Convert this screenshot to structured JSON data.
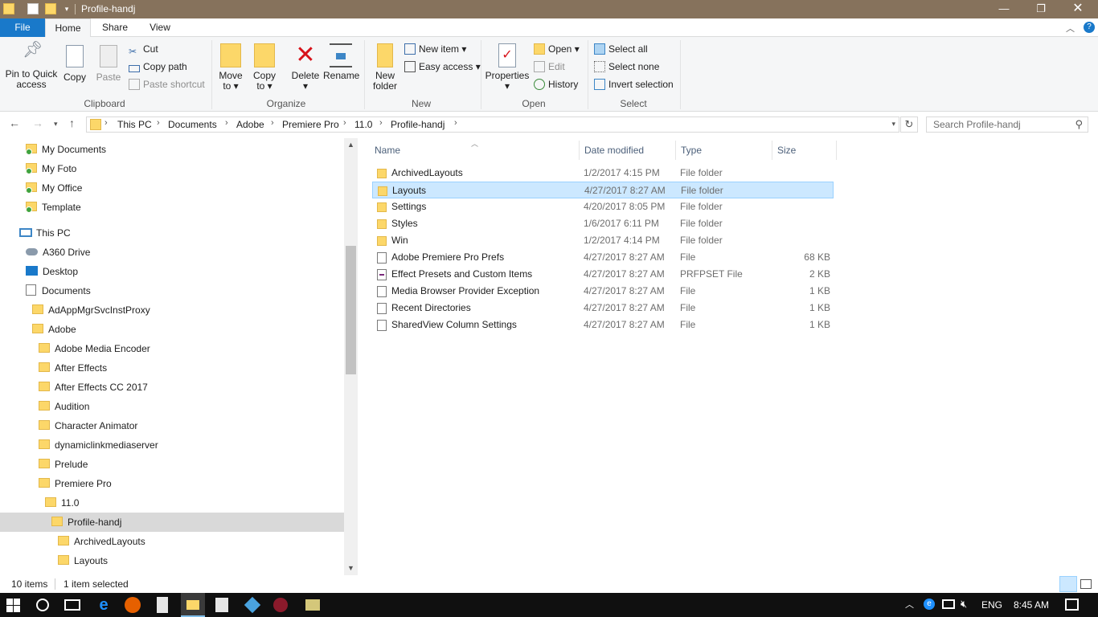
{
  "window": {
    "title": "Profile-handj"
  },
  "tabs": {
    "file": "File",
    "home": "Home",
    "share": "Share",
    "view": "View"
  },
  "ribbon": {
    "clipboard": {
      "label": "Clipboard",
      "pin_line1": "Pin to Quick",
      "pin_line2": "access",
      "copy": "Copy",
      "paste": "Paste",
      "cut": "Cut",
      "copy_path": "Copy path",
      "paste_shortcut": "Paste shortcut"
    },
    "organize": {
      "label": "Organize",
      "move_line1": "Move",
      "move_line2": "to",
      "copy_line1": "Copy",
      "copy_line2": "to",
      "delete": "Delete",
      "rename": "Rename"
    },
    "new": {
      "label": "New",
      "new_folder_line1": "New",
      "new_folder_line2": "folder",
      "new_item": "New item",
      "easy_access": "Easy access"
    },
    "open": {
      "label": "Open",
      "properties": "Properties",
      "open": "Open",
      "edit": "Edit",
      "history": "History"
    },
    "select": {
      "label": "Select",
      "select_all": "Select all",
      "select_none": "Select none",
      "invert": "Invert selection"
    }
  },
  "address": {
    "crumbs": [
      "This PC",
      "Documents",
      "Adobe",
      "Premiere Pro",
      "11.0",
      "Profile-handj"
    ],
    "search_placeholder": "Search Profile-handj"
  },
  "nav": {
    "items": [
      "My Documents",
      "My Foto",
      "My Office",
      "Template",
      "This PC",
      "A360 Drive",
      "Desktop",
      "Documents",
      "AdAppMgrSvcInstProxy",
      "Adobe",
      "Adobe Media Encoder",
      "After Effects",
      "After Effects CC 2017",
      "Audition",
      "Character Animator",
      "dynamiclinkmediaserver",
      "Prelude",
      "Premiere Pro",
      "11.0",
      "Profile-handj",
      "ArchivedLayouts",
      "Layouts"
    ]
  },
  "files": {
    "headers": {
      "name": "Name",
      "date": "Date modified",
      "type": "Type",
      "size": "Size"
    },
    "rows": [
      {
        "name": "ArchivedLayouts",
        "date": "1/2/2017 4:15 PM",
        "type": "File folder",
        "size": ""
      },
      {
        "name": "Layouts",
        "date": "4/27/2017 8:27 AM",
        "type": "File folder",
        "size": ""
      },
      {
        "name": "Settings",
        "date": "4/20/2017 8:05 PM",
        "type": "File folder",
        "size": ""
      },
      {
        "name": "Styles",
        "date": "1/6/2017 6:11 PM",
        "type": "File folder",
        "size": ""
      },
      {
        "name": "Win",
        "date": "1/2/2017 4:14 PM",
        "type": "File folder",
        "size": ""
      },
      {
        "name": "Adobe Premiere Pro Prefs",
        "date": "4/27/2017 8:27 AM",
        "type": "File",
        "size": "68 KB"
      },
      {
        "name": "Effect Presets and Custom Items",
        "date": "4/27/2017 8:27 AM",
        "type": "PRFPSET File",
        "size": "2 KB"
      },
      {
        "name": "Media Browser Provider Exception",
        "date": "4/27/2017 8:27 AM",
        "type": "File",
        "size": "1 KB"
      },
      {
        "name": "Recent Directories",
        "date": "4/27/2017 8:27 AM",
        "type": "File",
        "size": "1 KB"
      },
      {
        "name": "SharedView Column Settings",
        "date": "4/27/2017 8:27 AM",
        "type": "File",
        "size": "1 KB"
      }
    ]
  },
  "status": {
    "count": "10 items",
    "selected": "1 item selected"
  },
  "taskbar": {
    "lang": "ENG",
    "time": "8:45 AM"
  },
  "colors": {
    "accent": "#1979ca",
    "titlebar": "#86725c",
    "selection": "#cce8ff"
  }
}
